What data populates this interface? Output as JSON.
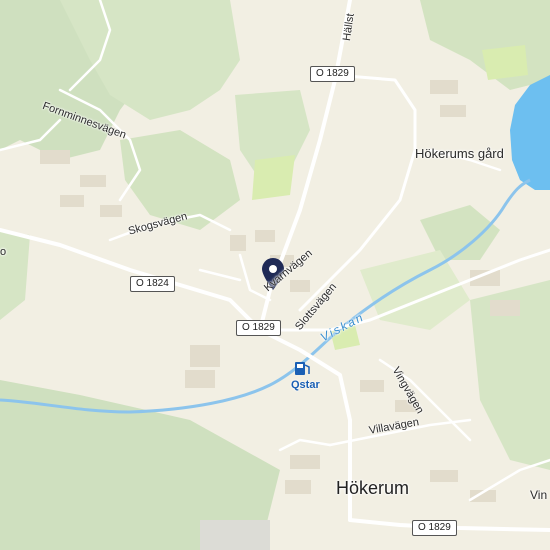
{
  "colors": {
    "background": "#f2efe3",
    "forest": "#cfe0bf",
    "light_green": "#e0ebcc",
    "field": "#d9ecb0",
    "water": "#6dbff0",
    "river": "#8cc4ec",
    "road": "#ffffff",
    "building": "#e2dccc",
    "marker": "#1f2a56"
  },
  "roads": {
    "route_shields": [
      "O 1829",
      "O 1824",
      "O 1829",
      "O 1829"
    ]
  },
  "streets": {
    "fornminnesvagen": "Fornminnesvägen",
    "skogsvagen": "Skogsvägen",
    "kvarnvagen": "Kvarnvägen",
    "slottsvagen": "Slottsvägen",
    "vingvagen": "Vingvägen",
    "villavagen": "Villavägen",
    "hallstad_partial": "Hällst",
    "left_edge_partial": "o",
    "right_edge_partial": "Vin"
  },
  "places": {
    "hokerums_gard": "Hökerums gård",
    "town": "Hökerum"
  },
  "water": {
    "river_name": "Viskan"
  },
  "poi": {
    "fuel_icon": "fuel-pump-icon",
    "fuel_name": "Qstar"
  },
  "marker": {
    "icon": "location-pin-icon"
  }
}
